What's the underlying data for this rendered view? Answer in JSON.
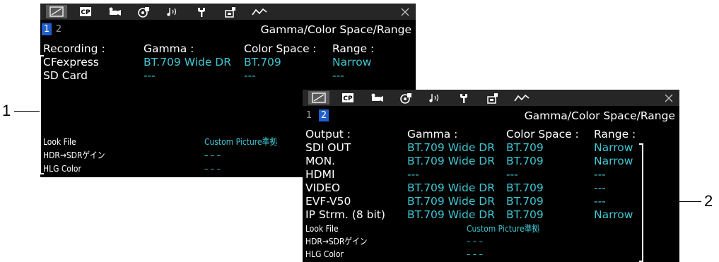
{
  "tab_icons": [
    "status-icon",
    "custom-picture-icon",
    "camera-icon",
    "media-icon",
    "audio-icon",
    "system-icon",
    "assignable-button-icon",
    "network-icon"
  ],
  "panel1": {
    "page_numbers": [
      "1",
      "2"
    ],
    "selected_page": "1",
    "screen_title": "Gamma/Color Space/Range",
    "headers": [
      "Recording :",
      "Gamma :",
      "Color Space :",
      "Range :"
    ],
    "rows": [
      {
        "label": "CFexpress",
        "gamma": "BT.709 Wide DR",
        "color_space": "BT.709",
        "range": "Narrow"
      },
      {
        "label": "SD Card",
        "gamma": "---",
        "color_space": "---",
        "range": "---"
      }
    ],
    "footer": [
      {
        "label": "Look File",
        "value": "Custom Picture準拠"
      },
      {
        "label": "HDR→SDRゲイン",
        "value": "– – –"
      },
      {
        "label": "HLG Color",
        "value": "– – –"
      }
    ]
  },
  "panel2": {
    "page_numbers": [
      "1",
      "2"
    ],
    "selected_page": "2",
    "screen_title": "Gamma/Color Space/Range",
    "headers": [
      "Output :",
      "Gamma :",
      "Color Space :",
      "Range :"
    ],
    "rows": [
      {
        "label": "SDI OUT",
        "gamma": "BT.709 Wide DR",
        "color_space": "BT.709",
        "range": "Narrow"
      },
      {
        "label": "MON.",
        "gamma": "BT.709 Wide DR",
        "color_space": "BT.709",
        "range": "Narrow"
      },
      {
        "label": "HDMI",
        "gamma": "---",
        "color_space": "---",
        "range": "---"
      },
      {
        "label": "VIDEO",
        "gamma": "BT.709 Wide DR",
        "color_space": "BT.709",
        "range": "---"
      },
      {
        "label": "EVF-V50",
        "gamma": "BT.709 Wide DR",
        "color_space": "BT.709",
        "range": "---"
      },
      {
        "label": "IP Strm. (8 bit)",
        "gamma": "BT.709 Wide DR",
        "color_space": "BT.709",
        "range": "Narrow"
      }
    ],
    "footer": [
      {
        "label": "Look File",
        "value": "Custom Picture準拠"
      },
      {
        "label": "HDR→SDRゲイン",
        "value": "– – –"
      },
      {
        "label": "HLG Color",
        "value": "– – –"
      }
    ]
  },
  "callouts": {
    "one": "1",
    "two": "2"
  },
  "colors": {
    "value_text": "#3fc6d2",
    "page_selected": "#1f5fcf",
    "background": "#000000"
  }
}
